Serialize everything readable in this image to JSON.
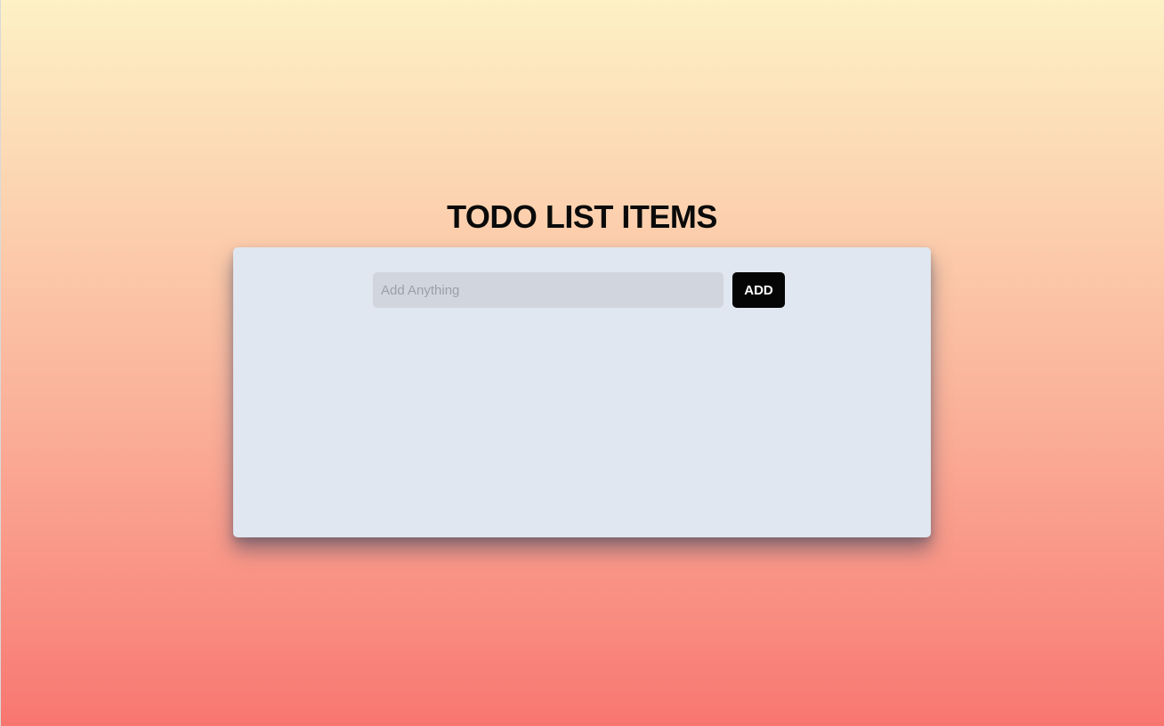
{
  "header": {
    "title": "TODO LIST ITEMS"
  },
  "form": {
    "input_placeholder": "Add Anything",
    "input_value": "",
    "add_label": "ADD"
  },
  "todo_items": [],
  "colors": {
    "background_top": "#fdf1c6",
    "background_bottom": "#f87670",
    "card_background": "#e0e7f0",
    "input_background": "#d1d5dd",
    "button_background": "#050505",
    "button_text": "#ffffff"
  }
}
